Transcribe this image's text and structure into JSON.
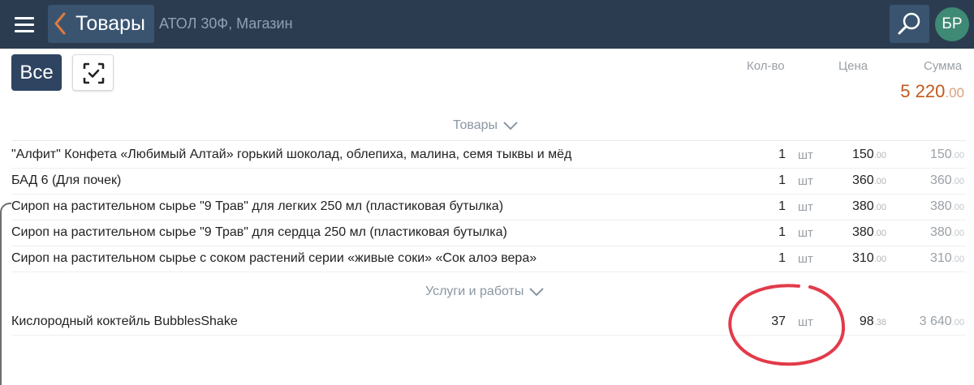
{
  "header": {
    "title": "Товары",
    "subtitle": "АТОЛ 30Ф, Магазин",
    "avatar": "БР",
    "bg_color": "#2b3c51"
  },
  "toolbar": {
    "all_label": "Все"
  },
  "columns": {
    "qty": "Кол-во",
    "price": "Цена",
    "sum": "Сумма"
  },
  "total": {
    "main": "5 220",
    "cents": ".00",
    "color": "#c25a1c"
  },
  "sections": [
    {
      "title": "Товары",
      "items": [
        {
          "name": "\"Алфит\" Конфета «Любимый Алтай» горький шоколад, облепиха, малина, семя тыквы и мёд",
          "qty": "1",
          "unit": "шт",
          "price": "150",
          "price_cents": ".00",
          "sum": "150",
          "sum_cents": ".00"
        },
        {
          "name": "БАД 6 (Для почек)",
          "qty": "1",
          "unit": "шт",
          "price": "360",
          "price_cents": ".00",
          "sum": "360",
          "sum_cents": ".00"
        },
        {
          "name": "Сироп на растительном сырье \"9 Трав\" для легких 250 мл (пластиковая бутылка)",
          "qty": "1",
          "unit": "шт",
          "price": "380",
          "price_cents": ".00",
          "sum": "380",
          "sum_cents": ".00"
        },
        {
          "name": "Сироп на растительном сырье \"9 Трав\" для сердца 250 мл (пластиковая бутылка)",
          "qty": "1",
          "unit": "шт",
          "price": "380",
          "price_cents": ".00",
          "sum": "380",
          "sum_cents": ".00"
        },
        {
          "name": "Сироп на растительном сырье с соком растений серии «живые соки» «Сок алоэ вера»",
          "qty": "1",
          "unit": "шт",
          "price": "310",
          "price_cents": ".00",
          "sum": "310",
          "sum_cents": ".00"
        }
      ]
    },
    {
      "title": "Услуги и работы",
      "items": [
        {
          "name": "Кислородный коктейль BubblesShake",
          "qty": "37",
          "unit": "шт",
          "price": "98",
          "price_cents": ".38",
          "sum": "3 640",
          "sum_cents": ".00"
        }
      ]
    }
  ],
  "annotation": {
    "color": "#e23b4a"
  }
}
